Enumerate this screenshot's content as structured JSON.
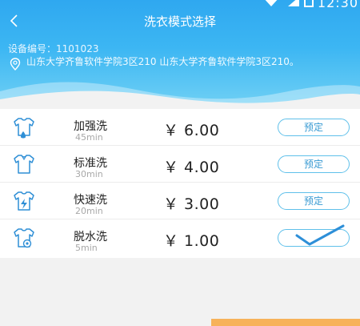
{
  "status_bar": {
    "time": "12:30"
  },
  "nav": {
    "title": "洗衣模式选择"
  },
  "device": {
    "label": "设备编号：",
    "number": "1101023"
  },
  "address": {
    "text": "山东大学齐鲁软件学院3区210 山东大学齐鲁软件学院3区210。"
  },
  "modes": [
    {
      "icon": "shirt-drop-icon",
      "name": "加强洗",
      "duration": "45min",
      "price": "￥ 6.00",
      "action": "预定",
      "selected": false
    },
    {
      "icon": "shirt-icon",
      "name": "标准洗",
      "duration": "30min",
      "price": "￥ 4.00",
      "action": "预定",
      "selected": false
    },
    {
      "icon": "shirt-lightning-icon",
      "name": "快速洗",
      "duration": "20min",
      "price": "￥ 3.00",
      "action": "预定",
      "selected": false
    },
    {
      "icon": "shirt-spin-icon",
      "name": "脱水洗",
      "duration": "5min",
      "price": "￥ 1.00",
      "action": "",
      "selected": true
    }
  ],
  "colors": {
    "header_top": "#2fa8f0",
    "accent": "#5fc0ea",
    "check": "#2e8fd8"
  }
}
